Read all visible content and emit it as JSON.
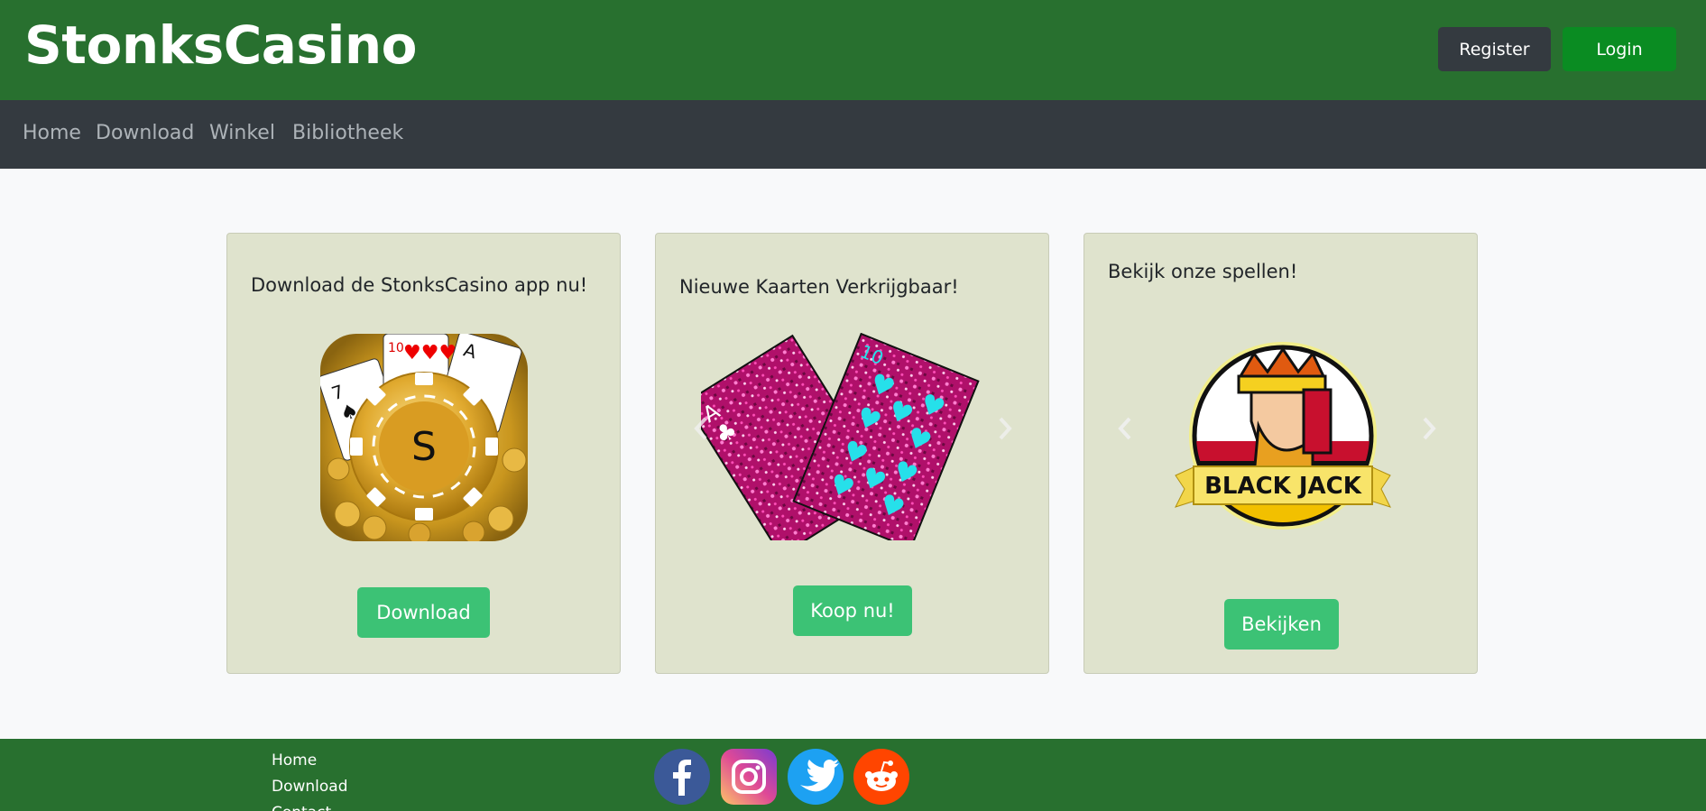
{
  "header": {
    "brand": "StonksCasino",
    "register_label": "Register",
    "login_label": "Login"
  },
  "nav": {
    "items": [
      {
        "label": "Home"
      },
      {
        "label": "Download"
      },
      {
        "label": "Winkel"
      },
      {
        "label": "Bibliotheek"
      }
    ]
  },
  "cards": [
    {
      "title": "Download de StonksCasino app nu!",
      "button_label": "Download",
      "image_icon": "stonkscasino-app-icon",
      "chip_letter": "S"
    },
    {
      "title": "Nieuwe Kaarten Verkrijgbaar!",
      "button_label": "Koop nu!",
      "image_icon": "playing-cards-image"
    },
    {
      "title": "Bekijk onze spellen!",
      "button_label": "Bekijken",
      "image_icon": "blackjack-logo-image",
      "logo_text": "BLACK JACK"
    }
  ],
  "footer": {
    "links": [
      {
        "label": "Home"
      },
      {
        "label": "Download"
      },
      {
        "label": "Contact"
      }
    ],
    "social": [
      {
        "name": "facebook-icon",
        "color": "#3b5998"
      },
      {
        "name": "instagram-icon",
        "color": "#d6249f"
      },
      {
        "name": "twitter-icon",
        "color": "#1da1f2"
      },
      {
        "name": "reddit-icon",
        "color": "#ff4500"
      }
    ]
  },
  "colors": {
    "header_bg": "#28702f",
    "nav_bg": "#343a40",
    "card_bg": "#dfe3cd",
    "card_button": "#3cc275",
    "login_button": "#0a8c22"
  }
}
